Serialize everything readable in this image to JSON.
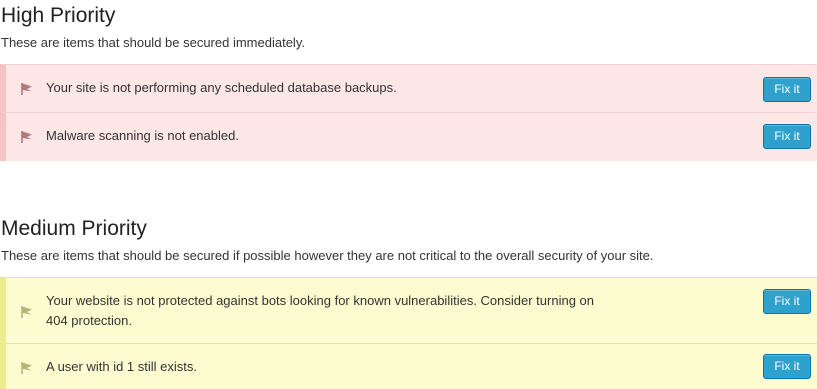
{
  "colors": {
    "high_bg": "#fde6e6",
    "high_accent": "#f4c4c4",
    "high_flag": "#b47a7a",
    "medium_bg": "#fcfcd0",
    "medium_accent": "#ecec8f",
    "medium_flag": "#b8b478",
    "button_bg": "#2ea2cc",
    "button_border": "#0e74a6"
  },
  "high": {
    "title": "High Priority",
    "description": "These are items that should be secured immediately.",
    "items": [
      {
        "icon": "flag-icon",
        "text": "Your site is not performing any scheduled database backups.",
        "button": "Fix it"
      },
      {
        "icon": "flag-icon",
        "text": "Malware scanning is not enabled.",
        "button": "Fix it"
      }
    ]
  },
  "medium": {
    "title": "Medium Priority",
    "description": "These are items that should be secured if possible however they are not critical to the overall security of your site.",
    "items": [
      {
        "icon": "flag-icon",
        "text_line1": "Your website is not protected against bots looking for known vulnerabilities. Consider turning on",
        "text_line2": "404 protection.",
        "button": "Fix it"
      },
      {
        "icon": "flag-icon",
        "text": "A user with id 1 still exists.",
        "button": "Fix it"
      }
    ]
  }
}
